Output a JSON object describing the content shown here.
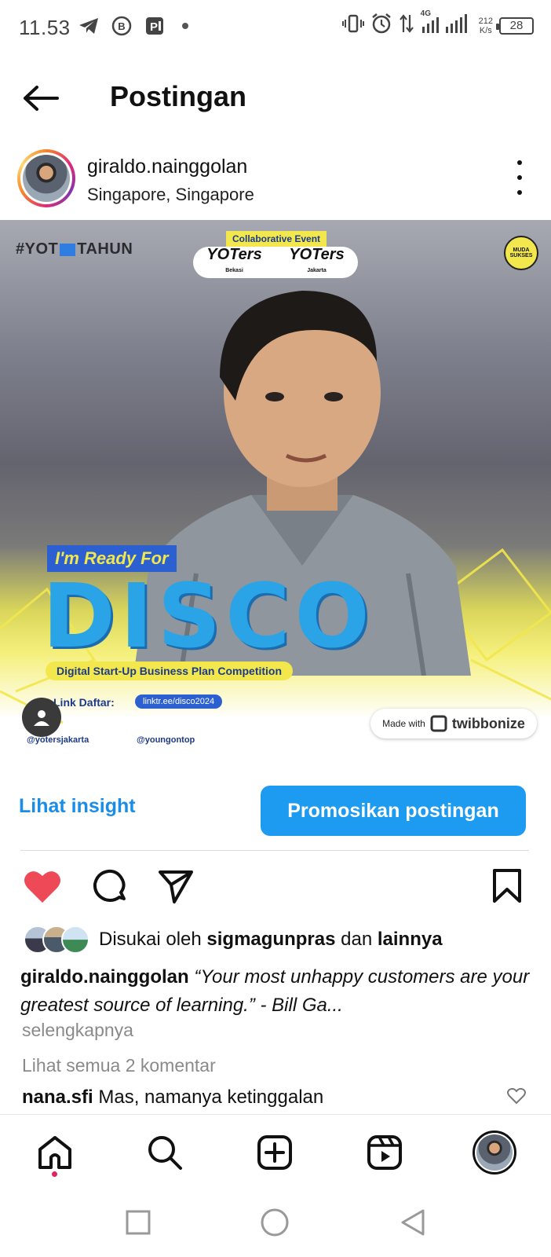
{
  "status_bar": {
    "time": "11.53",
    "network": "4G",
    "speed": "212",
    "speed_unit": "K/s",
    "battery": "28",
    "icons": [
      "telegram-icon",
      "b-icon",
      "parking-icon",
      "vibrate-icon",
      "alarm-icon",
      "data-arrows-icon",
      "signal-icon"
    ]
  },
  "header": {
    "title": "Postingan",
    "back_icon": "arrow-left-icon"
  },
  "post": {
    "username": "giraldo.nainggolan",
    "location": "Singapore, Singapore",
    "image": {
      "hashtag_left": "#YOT",
      "hashtag_right": "TAHUN",
      "collab_label": "Collaborative Event",
      "yoters_left": "YOTers",
      "yoters_right": "YOTers",
      "yoters_left_sub": "Bekasi",
      "yoters_right_sub": "Jakarta",
      "badge": "MUDA SUKSES",
      "ready_text": "I'm Ready For",
      "disco_text": "DISCO",
      "subtitle": "Digital Start-Up Business Plan Competition",
      "link_label": "Link Daftar:",
      "link_url": "linktr.ee/disco2024",
      "ig_handle_1": "@yotersjakarta",
      "ig_handle_2": "@youngontop",
      "twibbon_made": "Made with",
      "twibbon_brand": "twibbonize"
    },
    "insight_label": "Lihat insight",
    "promote_label": "Promosikan postingan",
    "likes_prefix": "Disukai oleh",
    "likes_user": "sigmagunpras",
    "likes_conj": "dan",
    "likes_suffix": "lainnya",
    "caption_user": "giraldo.nainggolan",
    "caption_text": "“Your most unhappy customers are your greatest source of learning.” - Bill Ga...",
    "caption_more": "selengkapnya",
    "comments_all": "Lihat semua 2 komentar",
    "comment_user": "nana.sfi",
    "comment_text": "Mas, namanya ketinggalan"
  },
  "colors": {
    "like_red": "#ed4956",
    "link_blue": "#1a8ee6",
    "button_blue": "#1d9bf0",
    "muted_gray": "#8a8a8a"
  },
  "bottom_nav": [
    "home-icon",
    "search-icon",
    "create-icon",
    "reels-icon",
    "profile-avatar"
  ],
  "system_nav": [
    "recents-icon",
    "home-circle-icon",
    "back-triangle-icon"
  ]
}
